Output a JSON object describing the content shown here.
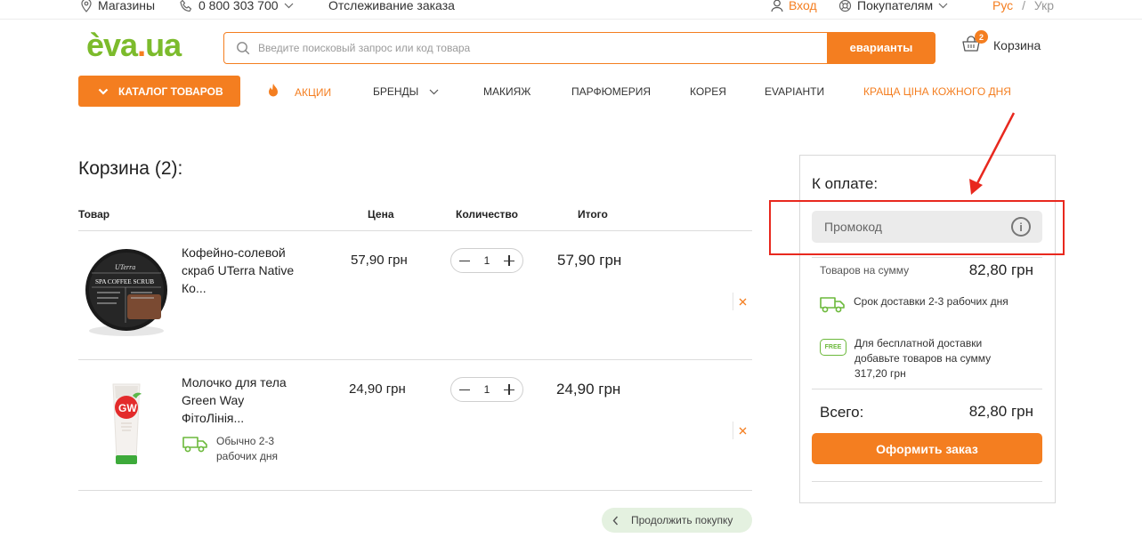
{
  "topbar": {
    "stores": "Магазины",
    "phone": "0 800 303 700",
    "track": "Отслеживание заказа",
    "login": "Вход",
    "buyers": "Покупателям",
    "lang_ru": "Рус",
    "lang_sep": " / ",
    "lang_uk": "Укр"
  },
  "header": {
    "logo_e": "è",
    "logo_va": "va",
    "logo_dot": ".",
    "logo_ua": "ua",
    "search_placeholder": "Введите поисковый запрос или код товара",
    "search_button": "eварианты",
    "cart_label": "Корзина",
    "cart_count": "2"
  },
  "nav": {
    "catalog": "КАТАЛОГ ТОВАРОВ",
    "items": [
      "АКЦИИ",
      "БРЕНДЫ",
      "МАКИЯЖ",
      "ПАРФЮМЕРИЯ",
      "КОРЕЯ",
      "EVAРІАНТИ",
      "КРАЩА ЦІНА КОЖНОГО ДНЯ"
    ]
  },
  "cart": {
    "title": "Корзина (2):",
    "columns": [
      "Товар",
      "Цена",
      "Количество",
      "Итого"
    ],
    "products": [
      {
        "name": "Кофейно-солевой скраб UTerra Native Ко...",
        "price": "57,90 грн",
        "qty": "1",
        "total": "57,90 грн",
        "image_text_brand": "UTerra",
        "image_text_line": "SPA COFFEE SCRUB"
      },
      {
        "name": "Молочко для тела Green Way ФітоЛінія...",
        "price": "24,90 грн",
        "qty": "1",
        "total": "24,90 грн",
        "image_text_brand": "GW",
        "delivery_note": "Обычно 2-3 рабочих дня"
      }
    ],
    "continue": "Продолжить покупку"
  },
  "summary": {
    "title": "К оплате:",
    "promo_placeholder": "Промокод",
    "subtotal_label": "Товаров на сумму",
    "subtotal_value": "82,80 грн",
    "delivery_text": "Срок доставки 2-3 рабочих дня",
    "free_badge": "FREE",
    "free_text": "Для бесплатной доставки добавьте товаров на сумму 317,20 грн",
    "total_label": "Всего:",
    "total_value": "82,80 грн",
    "order_button": "Оформить заказ"
  },
  "colors": {
    "accent": "#f47e20",
    "brand_green": "#7cbb2c",
    "annotation_red": "#e8281e",
    "continue_bg": "#e4f1e0"
  }
}
